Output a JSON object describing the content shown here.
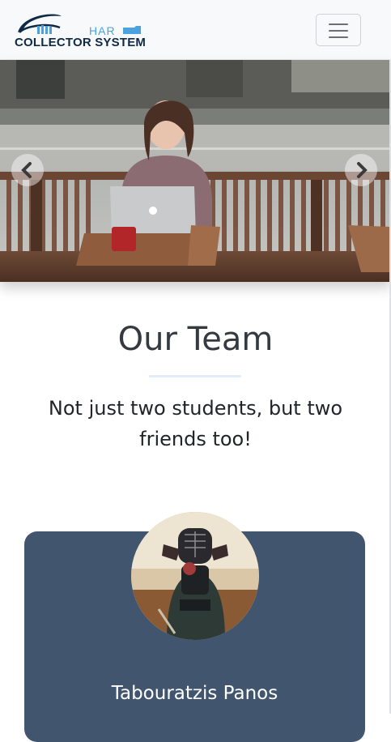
{
  "brand": {
    "logo_top": "HAR",
    "logo_bottom": "COLLECTOR SYSTEM"
  },
  "navbar": {
    "toggle_icon": "hamburger-menu-icon"
  },
  "carousel": {
    "image": "woman-with-laptop-photo",
    "prev_icon": "chevron-left-icon",
    "next_icon": "chevron-right-icon"
  },
  "team": {
    "title": "Our Team",
    "subtitle": "Not just two students, but two friends too!",
    "members": [
      {
        "name": "Tabouratzis Panos",
        "photo": "kendo-fighter-photo"
      }
    ]
  },
  "colors": {
    "navbar_bg": "#f8f9fa",
    "card_bg": "#41566e",
    "logo_blue": "#4aa3df",
    "logo_navy": "#0e2a47"
  }
}
